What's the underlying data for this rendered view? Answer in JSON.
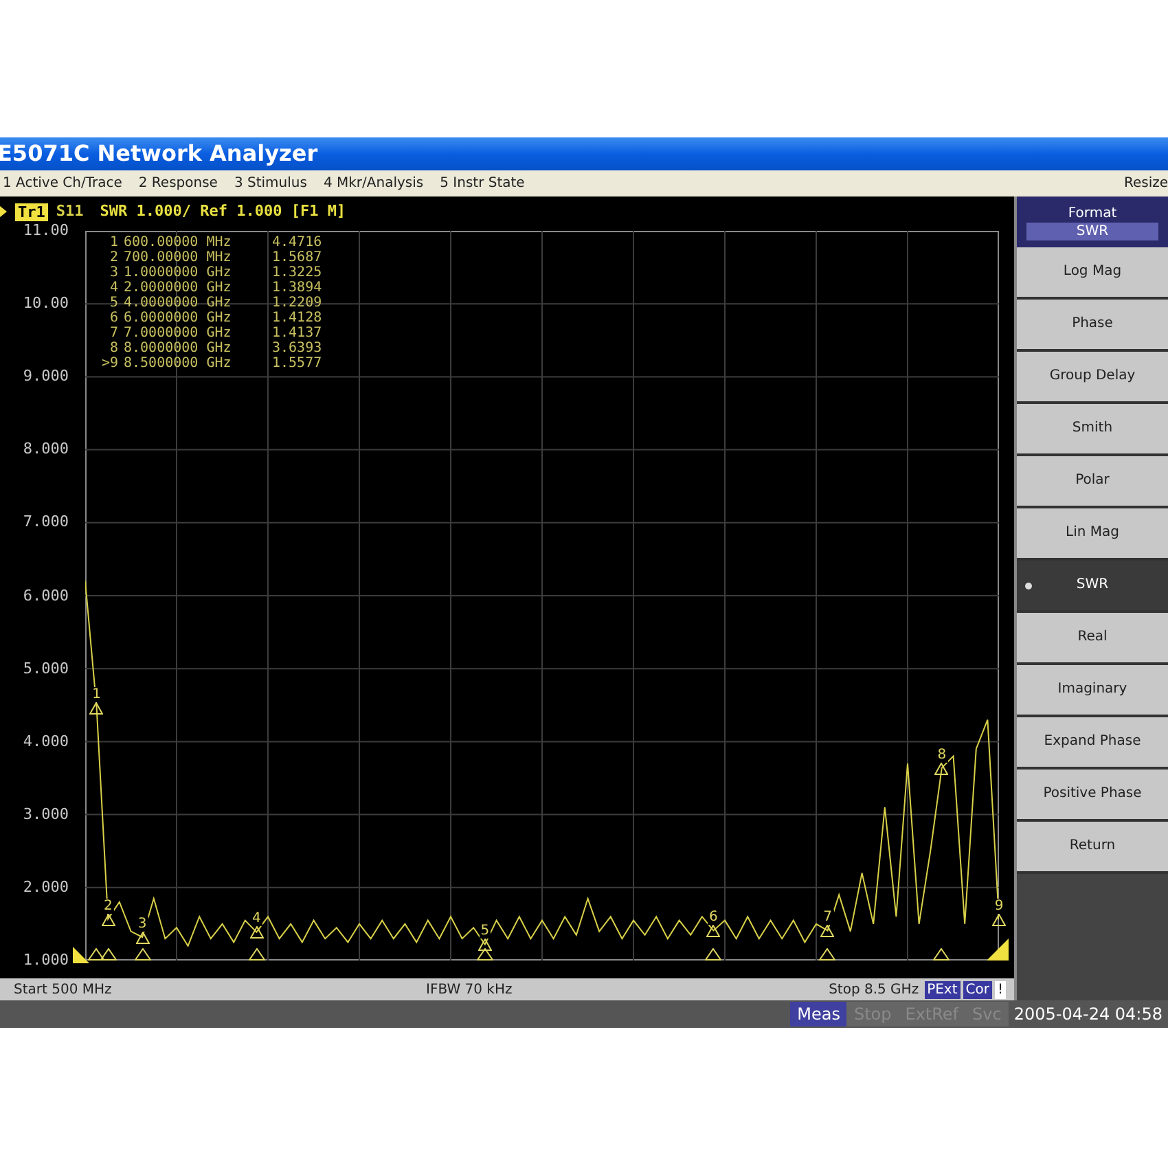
{
  "window": {
    "title": "E5071C Network Analyzer"
  },
  "menu": [
    "1 Active Ch/Trace",
    "2 Response",
    "3 Stimulus",
    "4 Mkr/Analysis",
    "5 Instr State"
  ],
  "menu_right": "Resize",
  "trace_header": {
    "trace": "Tr1",
    "text": "SWR 1.000/ Ref 1.000 [F1 M]"
  },
  "plot": {
    "chart_data": {
      "type": "line",
      "ylim": [
        1,
        11
      ],
      "grid": true,
      "yticks": [
        {
          "value": 11,
          "label": "11.00"
        },
        {
          "value": 10,
          "label": "10.00"
        },
        {
          "value": 9,
          "label": "9.000"
        },
        {
          "value": 8,
          "label": "8.000"
        },
        {
          "value": 7,
          "label": "7.000"
        },
        {
          "value": 6,
          "label": "6.000"
        },
        {
          "value": 5,
          "label": "5.000"
        },
        {
          "value": 4,
          "label": "4.000"
        },
        {
          "value": 3,
          "label": "3.000"
        },
        {
          "value": 2,
          "label": "2.000"
        },
        {
          "value": 1,
          "label": "1.000"
        }
      ],
      "categories": [
        null,
        null,
        null,
        null,
        null,
        null,
        null,
        null,
        null,
        null,
        null,
        null,
        null,
        null,
        null,
        null,
        null,
        null,
        null,
        null,
        null,
        null,
        null,
        null,
        null,
        null,
        null,
        null,
        null,
        null,
        null,
        null,
        null,
        null,
        null,
        null,
        null,
        null,
        null,
        null,
        null,
        null,
        null,
        null,
        null,
        null,
        null,
        null,
        null,
        null,
        null,
        null,
        null,
        null,
        null,
        null,
        null,
        null,
        null,
        null,
        null,
        null,
        null,
        null,
        null,
        null,
        null,
        null,
        null,
        null,
        null,
        null,
        null,
        null,
        null,
        null,
        null,
        null,
        null,
        null,
        null
      ],
      "series": [
        {
          "name": "S11",
          "color": "#d8d048",
          "values": [
            6.2,
            4.47,
            1.57,
            1.8,
            1.4,
            1.32,
            1.85,
            1.3,
            1.45,
            1.2,
            1.6,
            1.3,
            1.5,
            1.25,
            1.55,
            1.39,
            1.6,
            1.3,
            1.5,
            1.25,
            1.55,
            1.3,
            1.45,
            1.25,
            1.5,
            1.3,
            1.55,
            1.3,
            1.5,
            1.25,
            1.55,
            1.3,
            1.6,
            1.3,
            1.45,
            1.22,
            1.55,
            1.3,
            1.6,
            1.3,
            1.55,
            1.3,
            1.6,
            1.35,
            1.85,
            1.4,
            1.6,
            1.3,
            1.55,
            1.35,
            1.6,
            1.3,
            1.55,
            1.35,
            1.6,
            1.41,
            1.55,
            1.3,
            1.6,
            1.3,
            1.55,
            1.3,
            1.55,
            1.25,
            1.5,
            1.41,
            1.9,
            1.4,
            2.2,
            1.5,
            3.1,
            1.6,
            3.7,
            1.5,
            2.5,
            3.64,
            3.8,
            1.5,
            3.9,
            4.3,
            1.56
          ]
        }
      ]
    }
  },
  "marker_table": [
    {
      "index": "1",
      "stimulus": "600.00000 MHz",
      "value": "4.4716"
    },
    {
      "index": "2",
      "stimulus": "700.00000 MHz",
      "value": "1.5687"
    },
    {
      "index": "3",
      "stimulus": "1.0000000 GHz",
      "value": "1.3225"
    },
    {
      "index": "4",
      "stimulus": "2.0000000 GHz",
      "value": "1.3894"
    },
    {
      "index": "5",
      "stimulus": "4.0000000 GHz",
      "value": "1.2209"
    },
    {
      "index": "6",
      "stimulus": "6.0000000 GHz",
      "value": "1.4128"
    },
    {
      "index": "7",
      "stimulus": "7.0000000 GHz",
      "value": "1.4137"
    },
    {
      "index": "8",
      "stimulus": "8.0000000 GHz",
      "value": "3.6393"
    },
    {
      "index": ">9",
      "stimulus": "8.5000000 GHz",
      "value": "1.5577"
    }
  ],
  "trace_markers": [
    "1",
    "2",
    "3",
    "4",
    "5",
    "6",
    "7",
    "8",
    "9"
  ],
  "status_bar": {
    "start": "Start 500 MHz",
    "ifbw": "IFBW 70 kHz",
    "stop": "Stop 8.5 GHz",
    "badges": [
      "PExt",
      "Cor"
    ],
    "warning": "!"
  },
  "softkeys": {
    "title": "Format",
    "value": "SWR",
    "items": [
      {
        "label": "Log Mag",
        "selected": false
      },
      {
        "label": "Phase",
        "selected": false
      },
      {
        "label": "Group Delay",
        "selected": false
      },
      {
        "label": "Smith",
        "selected": false
      },
      {
        "label": "Polar",
        "selected": false
      },
      {
        "label": "Lin Mag",
        "selected": false
      },
      {
        "label": "SWR",
        "selected": true
      },
      {
        "label": "Real",
        "selected": false
      },
      {
        "label": "Imaginary",
        "selected": false
      },
      {
        "label": "Expand Phase",
        "selected": false
      },
      {
        "label": "Positive Phase",
        "selected": false
      },
      {
        "label": "Return",
        "selected": false
      }
    ]
  },
  "bottom_bar": {
    "items": [
      {
        "label": "Meas",
        "disabled": false
      },
      {
        "label": "Stop",
        "disabled": true
      },
      {
        "label": "ExtRef",
        "disabled": true
      },
      {
        "label": "Svc",
        "disabled": true
      }
    ],
    "datetime": "2005-04-24 04:58"
  }
}
